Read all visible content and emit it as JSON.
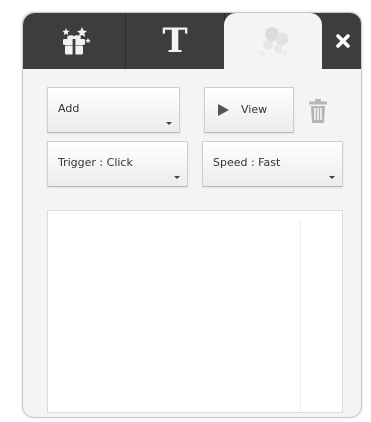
{
  "tabs": [
    {
      "name": "effects",
      "icon": "gift-box-stars-icon",
      "active": false
    },
    {
      "name": "text",
      "glyph": "T",
      "active": false
    },
    {
      "name": "animation",
      "icon": "bubbles-icon",
      "active": true
    }
  ],
  "close": {
    "icon": "close-icon"
  },
  "controls": {
    "add_label": "Add",
    "view_label": "View",
    "trash_icon": "trash-icon",
    "trigger_label": "Trigger : Click",
    "speed_label": "Speed : Fast"
  },
  "colors": {
    "tabbar": "#3d3d3d",
    "panel": "#f4f4f4",
    "button_text": "#333333"
  }
}
